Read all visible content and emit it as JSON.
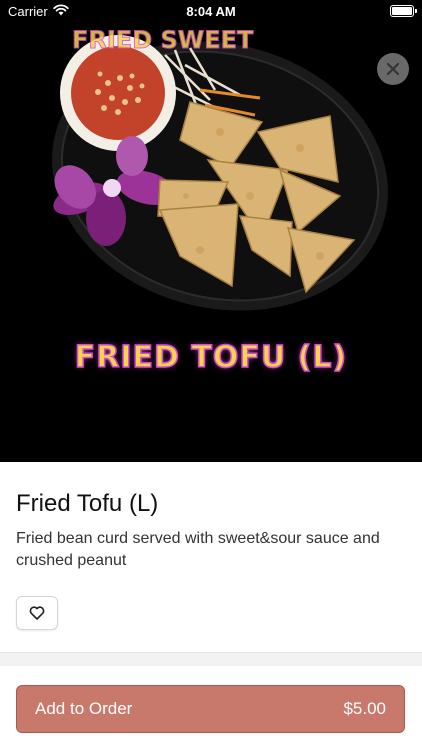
{
  "status_bar": {
    "carrier": "Carrier",
    "time": "8:04 AM",
    "wifi_icon": "wifi-icon",
    "battery_icon": "battery-icon"
  },
  "hero": {
    "caption": "FRIED TOFU (L)",
    "caption_top_partial": "FRIED SWEET",
    "close_icon": "close-icon"
  },
  "item": {
    "title": "Fried Tofu (L)",
    "description": "Fried bean curd served with sweet&sour sauce and crushed peanut",
    "favorite_icon": "heart-icon"
  },
  "footer": {
    "add_label": "Add to Order",
    "price": "$5.00"
  },
  "colors": {
    "button": "#c8796c",
    "caption_fill": "#f7d44a",
    "caption_stroke": "#d44fd0"
  }
}
